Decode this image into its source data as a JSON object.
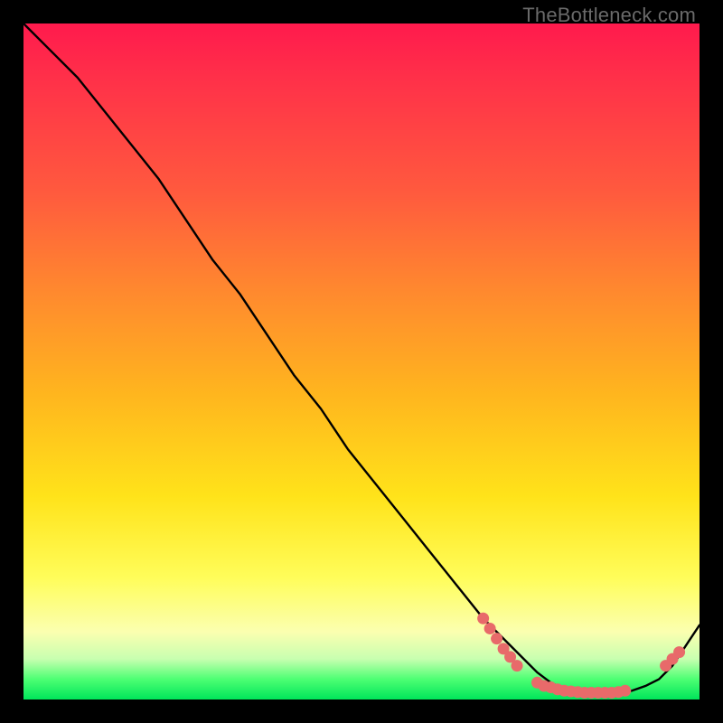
{
  "watermark": "TheBottleneck.com",
  "colors": {
    "background": "#000000",
    "curve_stroke": "#000000",
    "marker_fill": "#e86a6a",
    "marker_stroke": "#c44d4d"
  },
  "chart_data": {
    "type": "line",
    "title": "",
    "xlabel": "",
    "ylabel": "",
    "xlim": [
      0,
      100
    ],
    "ylim": [
      0,
      100
    ],
    "grid": false,
    "legend": false,
    "x": [
      0,
      4,
      8,
      12,
      16,
      20,
      24,
      28,
      32,
      36,
      40,
      44,
      48,
      52,
      56,
      60,
      64,
      68,
      72,
      74,
      76,
      78,
      80,
      82,
      84,
      86,
      88,
      90,
      92,
      94,
      96,
      98,
      100
    ],
    "y": [
      100,
      96,
      92,
      87,
      82,
      77,
      71,
      65,
      60,
      54,
      48,
      43,
      37,
      32,
      27,
      22,
      17,
      12,
      8,
      6,
      4,
      2.5,
      1.5,
      1,
      1,
      1,
      1,
      1.3,
      2,
      3,
      5,
      8,
      11
    ],
    "marker_points": [
      {
        "x": 68,
        "y": 12
      },
      {
        "x": 69,
        "y": 10.5
      },
      {
        "x": 70,
        "y": 9
      },
      {
        "x": 71,
        "y": 7.5
      },
      {
        "x": 72,
        "y": 6.3
      },
      {
        "x": 73,
        "y": 5
      },
      {
        "x": 76,
        "y": 2.5
      },
      {
        "x": 77,
        "y": 2
      },
      {
        "x": 78,
        "y": 1.8
      },
      {
        "x": 79,
        "y": 1.5
      },
      {
        "x": 80,
        "y": 1.3
      },
      {
        "x": 81,
        "y": 1.2
      },
      {
        "x": 82,
        "y": 1.1
      },
      {
        "x": 83,
        "y": 1
      },
      {
        "x": 84,
        "y": 1
      },
      {
        "x": 85,
        "y": 1
      },
      {
        "x": 86,
        "y": 1
      },
      {
        "x": 87,
        "y": 1
      },
      {
        "x": 88,
        "y": 1.1
      },
      {
        "x": 89,
        "y": 1.3
      },
      {
        "x": 95,
        "y": 5
      },
      {
        "x": 96,
        "y": 6
      },
      {
        "x": 97,
        "y": 7
      }
    ]
  }
}
